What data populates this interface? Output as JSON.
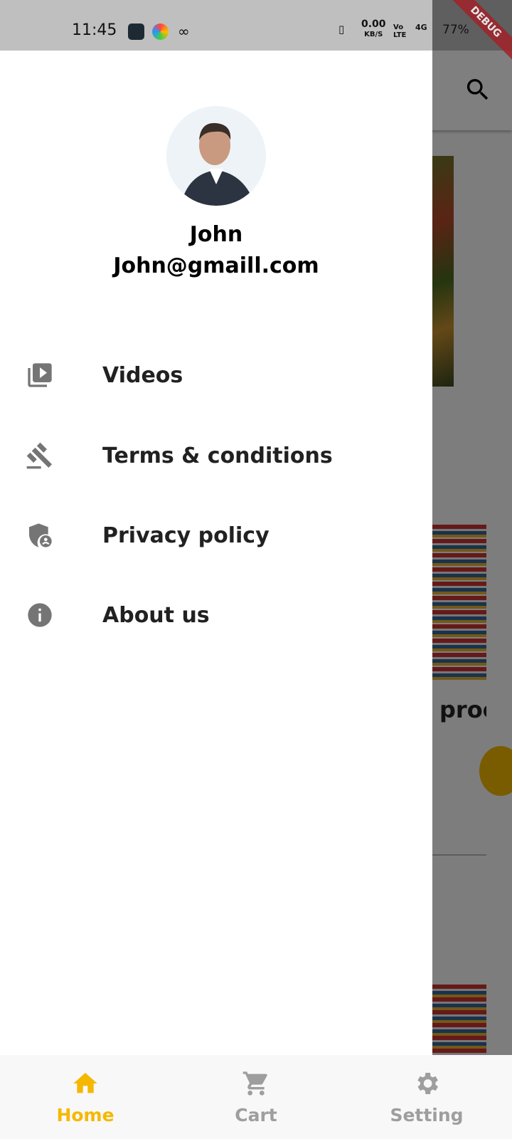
{
  "status_bar": {
    "time": "11:45",
    "network_speed": "0.00",
    "network_unit": "KB/S",
    "volte": "Vo LTE",
    "signal": "4G",
    "battery": "77%"
  },
  "debug_banner": "DEBUG",
  "drawer": {
    "user": {
      "name": "John",
      "email": "John@gmaill.com"
    },
    "items": [
      {
        "label": "Videos",
        "icon": "video-library-icon"
      },
      {
        "label": "Terms & conditions",
        "icon": "gavel-icon"
      },
      {
        "label": "Privacy policy",
        "icon": "admin-shield-icon"
      },
      {
        "label": "About us",
        "icon": "info-icon"
      }
    ]
  },
  "background": {
    "partial_text": "proc"
  },
  "bottom_nav": {
    "items": [
      {
        "label": "Home",
        "icon": "home-icon",
        "active": true
      },
      {
        "label": "Cart",
        "icon": "cart-icon"
      },
      {
        "label": "Setting",
        "icon": "gear-icon"
      }
    ],
    "active_color": "#f5b800",
    "inactive_color": "#9e9e9e"
  }
}
